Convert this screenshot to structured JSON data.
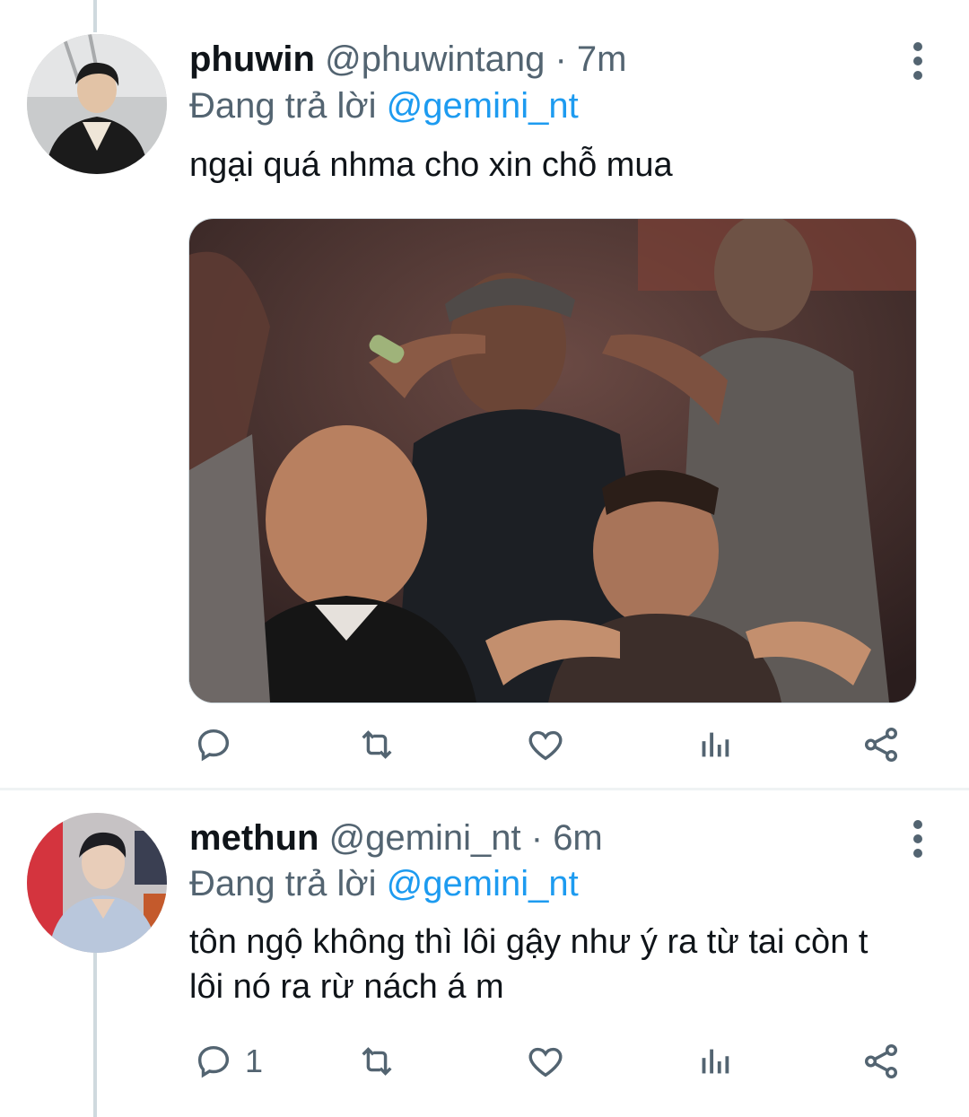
{
  "tweets": [
    {
      "name": "phuwin",
      "handle": "@phuwintang",
      "separator": "·",
      "time": "7m",
      "reply_prefix": "Đang trả lời",
      "reply_mention": "@gemini_nt",
      "text": "ngại quá nhma cho xin chỗ mua",
      "has_media": true,
      "reply_count": "",
      "avatar_icon": "person-portrait"
    },
    {
      "name": "methun",
      "handle": "@gemini_nt",
      "separator": "·",
      "time": "6m",
      "reply_prefix": "Đang trả lời",
      "reply_mention": "@gemini_nt",
      "text_line1": "tôn ngộ không thì lôi gậy như ý ra từ tai còn t",
      "text_line2": "lôi nó ra rừ nách á m",
      "has_media": false,
      "reply_count": "1",
      "avatar_icon": "person-portrait"
    }
  ],
  "icons": {
    "reply": "reply-icon",
    "retweet": "retweet-icon",
    "like": "like-icon",
    "analytics": "analytics-icon",
    "share": "share-icon",
    "more": "more-vertical-icon"
  },
  "colors": {
    "accent": "#1d9bf0",
    "secondary_text": "#536471",
    "primary_text": "#0f1419",
    "thread_line": "#cfd9de"
  }
}
